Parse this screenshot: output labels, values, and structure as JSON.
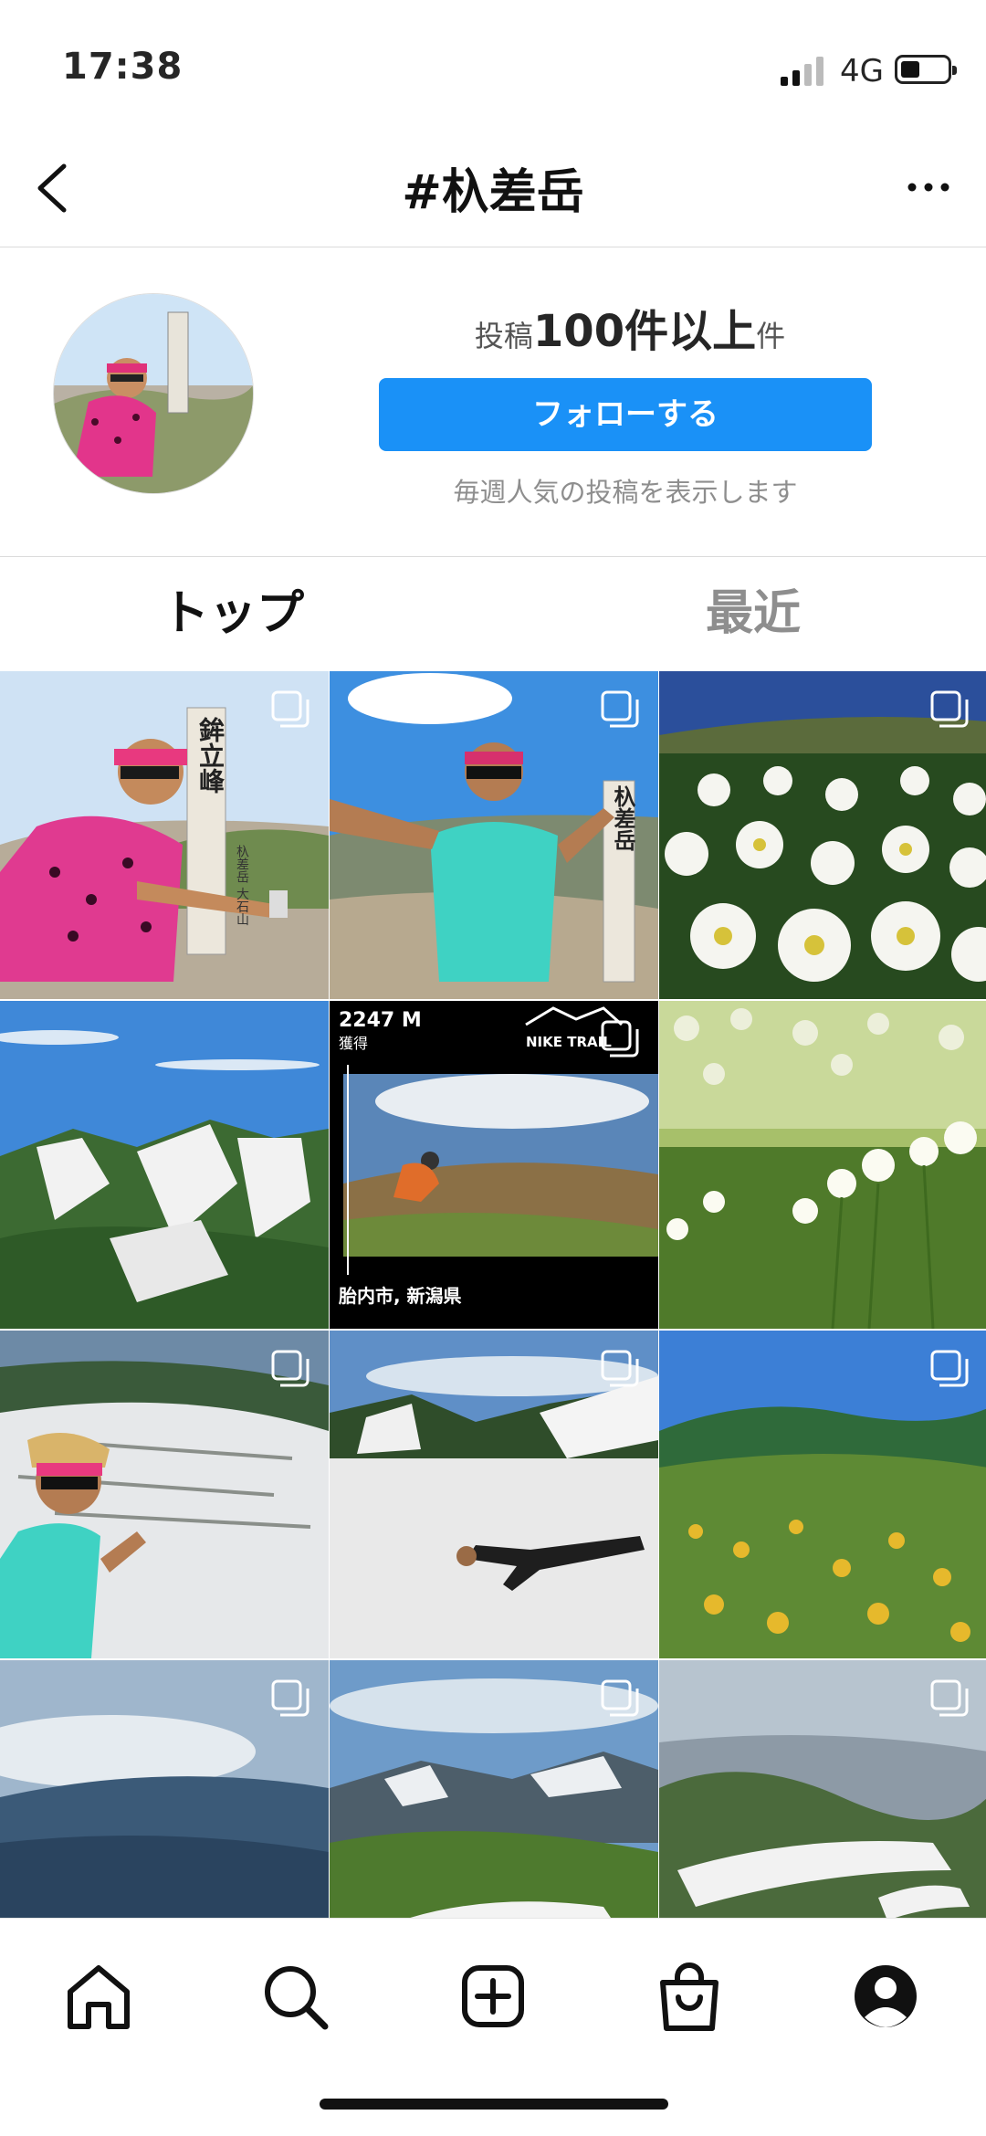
{
  "status_bar": {
    "time": "17:38",
    "network": "4G"
  },
  "header": {
    "title": "#杁差岳"
  },
  "tag_info": {
    "posts_label": "投稿",
    "posts_count": "100件以上",
    "posts_suffix": "件",
    "follow_label": "フォローする",
    "hint": "毎週人気の投稿を表示します"
  },
  "tabs": [
    {
      "label": "トップ",
      "selected": true
    },
    {
      "label": "最近",
      "selected": false
    }
  ],
  "grid_overlays": {
    "sign1": "鉾立峰",
    "sign1_sub": "杁差岳 大石山",
    "sign2": "杁差岳",
    "nike_distance": "2247 M",
    "nike_gain": "獲得",
    "nike_brand": "NIKE TRAIL",
    "nike_location": "胎内市, 新潟県"
  },
  "bottom_nav": [
    "home-icon",
    "search-icon",
    "new-post-icon",
    "shop-icon",
    "profile-icon"
  ],
  "colors": {
    "accent": "#1a91f7",
    "text": "#262626",
    "muted": "#8e8e8e"
  }
}
